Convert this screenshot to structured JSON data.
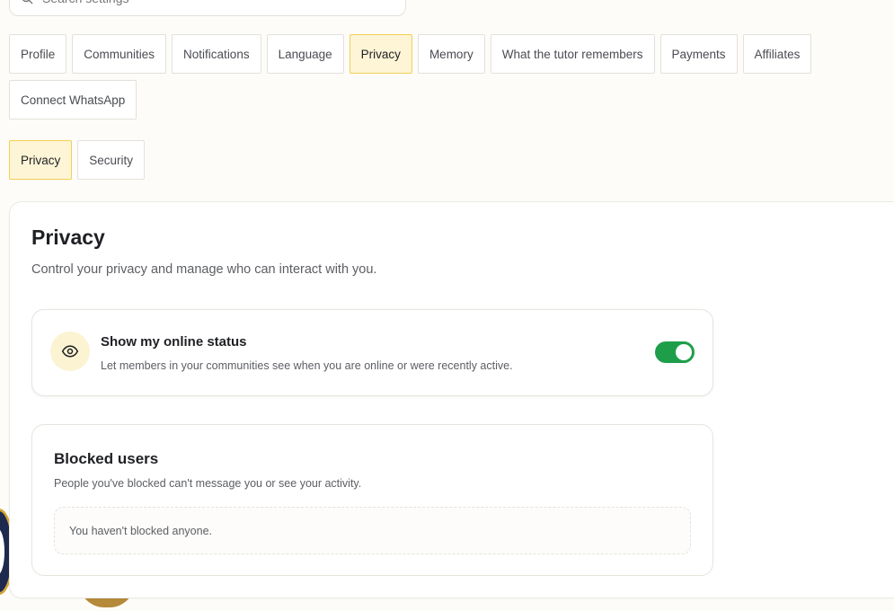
{
  "search": {
    "placeholder": "Search settings"
  },
  "tabs_row1": [
    "Profile",
    "Communities",
    "Notifications",
    "Language",
    "Privacy",
    "Memory",
    "What the tutor remembers",
    "Payments",
    "Affiliates"
  ],
  "tabs_row2": [
    "Connect WhatsApp"
  ],
  "active_tab": "Privacy",
  "subtabs": [
    "Privacy",
    "Security"
  ],
  "active_subtab": "Privacy",
  "privacy": {
    "title": "Privacy",
    "description": "Control your privacy and manage who can interact with you.",
    "online_status": {
      "title": "Show my online status",
      "description": "Let members in your communities see when you are online or were recently active.",
      "enabled": true,
      "icon": "eye-icon"
    },
    "blocked": {
      "title": "Blocked users",
      "description": "People you've blocked can't message you or see your activity.",
      "empty_text": "You haven't blocked anyone."
    }
  },
  "colors": {
    "accent_bg": "#fdf5d6",
    "accent_border": "#f1cf58",
    "toggle_on": "#1f9e4a"
  }
}
